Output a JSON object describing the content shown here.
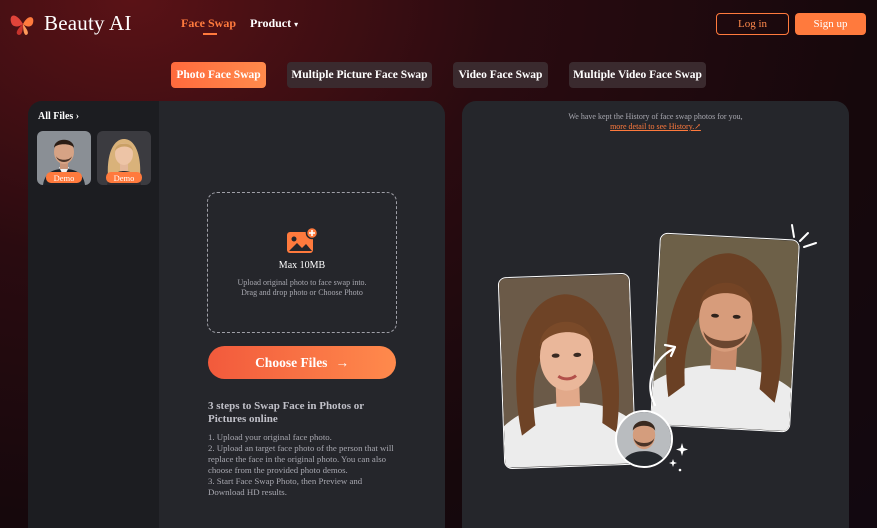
{
  "header": {
    "logo_text": "Beauty AI",
    "logo_icon": "butterfly-icon",
    "nav": [
      {
        "label": "Face Swap",
        "active": true
      },
      {
        "label": "Product",
        "has_dropdown": true
      }
    ],
    "login_label": "Log in",
    "signup_label": "Sign up"
  },
  "tabs": [
    {
      "label": "Photo Face Swap",
      "active": true
    },
    {
      "label": "Multiple Picture Face Swap",
      "active": false
    },
    {
      "label": "Video Face Swap",
      "active": false
    },
    {
      "label": "Multiple Video Face Swap",
      "active": false
    }
  ],
  "sidebar": {
    "all_files_label": "All Files",
    "thumbnails": [
      {
        "badge": "Demo"
      },
      {
        "badge": "Demo"
      }
    ]
  },
  "upload": {
    "max_size": "Max 10MB",
    "hint_line1": "Upload original photo to face swap into.",
    "hint_line2": "Drag and drop photo or Choose Photo",
    "choose_button": "Choose Files",
    "arrow": "→"
  },
  "steps": {
    "title": "3 steps to Swap Face in Photos or Pictures online",
    "items": [
      "1. Upload your original face photo.",
      "2. Upload an target face photo of the person that will replace the face in the original photo. You can also choose from the provided photo demos.",
      "3. Start Face Swap Photo, then Preview and Download HD results."
    ]
  },
  "history": {
    "note": "We have kept the History of face swap photos for you,",
    "link": "more detail to see History.↗"
  },
  "colors": {
    "accent": "#ff7a3d",
    "panel": "#25262b",
    "sidebar": "#1c1d21"
  }
}
